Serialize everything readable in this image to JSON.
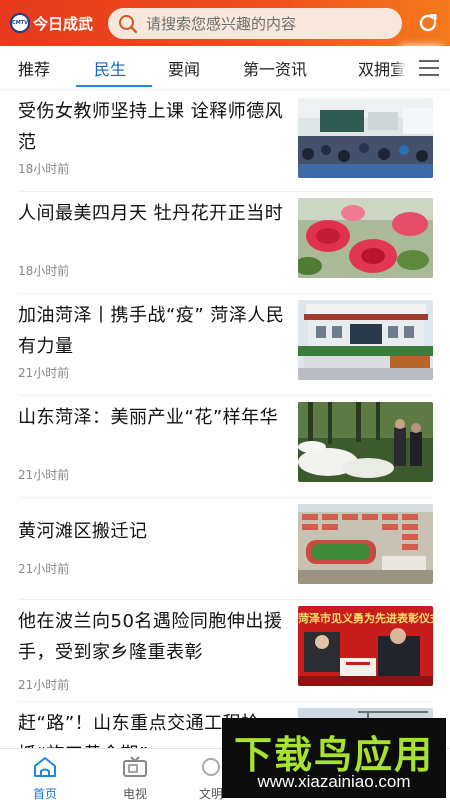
{
  "header": {
    "logo_badge": "CMTV",
    "logo_text": "今日成武",
    "search_placeholder": "请搜索您感兴趣的内容",
    "brand_color": "#e94a1f"
  },
  "tabs": [
    {
      "label": "推荐",
      "active": false
    },
    {
      "label": "民生",
      "active": true
    },
    {
      "label": "要闻",
      "active": false
    },
    {
      "label": "第一资讯",
      "active": false
    },
    {
      "label": "双拥宣",
      "active": false
    }
  ],
  "news": [
    {
      "title": "受伤女教师坚持上课 诠释师德风范",
      "time": "18小时前",
      "image": "classroom"
    },
    {
      "title": "人间最美四月天 牡丹花开正当时",
      "time": "18小时前",
      "image": "peony"
    },
    {
      "title": "加油菏泽丨携手战“疫” 菏泽人民有力量",
      "time": "21小时前",
      "image": "building"
    },
    {
      "title": "山东菏泽：美丽产业“花”样年华",
      "time": "21小时前",
      "image": "flower-field"
    },
    {
      "title": "黄河滩区搬迁记",
      "time": "21小时前",
      "image": "aerial-village"
    },
    {
      "title": "他在波兰向50名遇险同胞伸出援手，受到家乡隆重表彰",
      "time": "21小时前",
      "image": "ceremony",
      "thumb_text": "菏泽市见义勇为先进表彰仪式"
    },
    {
      "title": "赶“路”！山东重点交通工程抢抓“施工黄金期”",
      "time": "",
      "image": "construction"
    }
  ],
  "bottom_nav": [
    {
      "label": "首页",
      "icon": "home-icon",
      "active": true
    },
    {
      "label": "电视",
      "icon": "tv-icon",
      "active": false
    },
    {
      "label": "文明",
      "icon": "civilization-icon",
      "active": false
    }
  ],
  "watermark": {
    "title": "下载鸟应用",
    "url": "www.xiazainiao.com"
  }
}
